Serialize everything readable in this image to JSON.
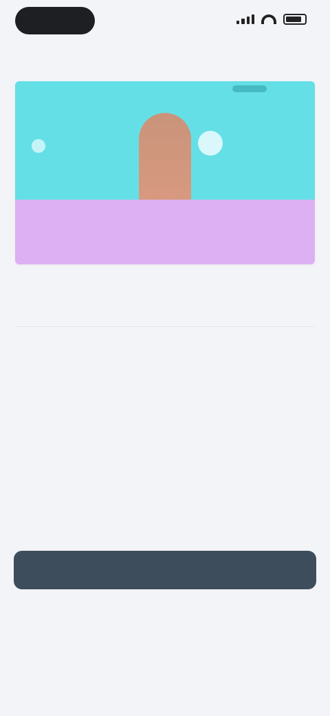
{
  "status_bar": {
    "time": ""
  },
  "header": {
    "top_link": ""
  },
  "hero": {
    "caption_small": "",
    "caption_title": ""
  },
  "section": {
    "label": ""
  },
  "content": {
    "step_label": "",
    "intro": "",
    "body_1": "",
    "body_2": "",
    "faint": ""
  },
  "actions": {
    "primary_label": "",
    "note_1": "",
    "note_2": "",
    "link_label": ""
  },
  "colors": {
    "hero_top": "#65dfe6",
    "hero_bottom": "#dcb0f3",
    "button": "#3d4d5b",
    "link": "#7c8ee6",
    "background": "#f3f4f7"
  }
}
